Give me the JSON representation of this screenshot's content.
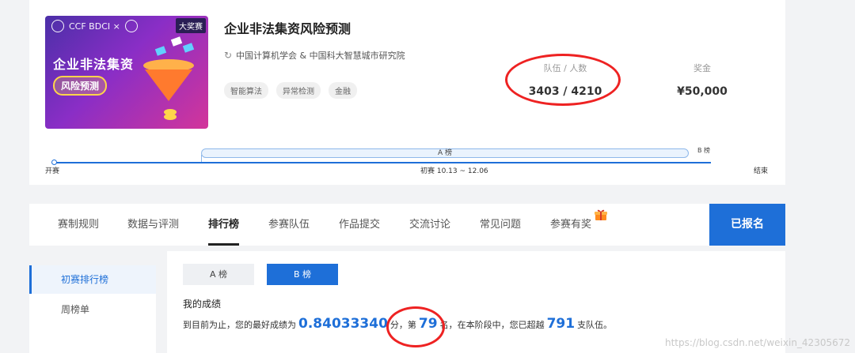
{
  "competition": {
    "banner": {
      "logo_text": "CCF BDCI ×",
      "tag": "大奖赛",
      "title": "企业非法集资",
      "subtitle": "风险预测"
    },
    "title": "企业非法集资风险预测",
    "organizers": "中国计算机学会 & 中国科大智慧城市研究院",
    "tags": [
      "智能算法",
      "异常检测",
      "金融"
    ],
    "stats": {
      "teams_label": "队伍 / 人数",
      "teams_value": "3403 / 4210",
      "prize_label": "奖金",
      "prize_value": "¥50,000"
    }
  },
  "timeline": {
    "start": "开赛",
    "stage": "初赛 10.13 ~ 12.06",
    "end": "结束",
    "a_board": "A 榜",
    "b_board": "B 榜"
  },
  "nav": {
    "tabs": [
      "赛制规则",
      "数据与评测",
      "排行榜",
      "参赛队伍",
      "作品提交",
      "交流讨论",
      "常见问题",
      "参赛有奖"
    ],
    "active_tab": "排行榜",
    "signup": "已报名"
  },
  "sidebar": {
    "items": [
      "初赛排行榜",
      "周榜单"
    ],
    "active": "初赛排行榜"
  },
  "leaderboard": {
    "tab_a": "A 榜",
    "tab_b": "B 榜",
    "active_tab": "B 榜",
    "my_score_label": "我的成绩",
    "prefix": "到目前为止，您的最好成绩为",
    "best_score": "0.84033340",
    "score_unit": "分，",
    "rank_prefix": "第",
    "rank": "79",
    "rank_suffix": "名，在本阶段中，您已超越",
    "surpassed": "791",
    "surpassed_suffix": "支队伍。"
  },
  "watermark": "https://blog.csdn.net/weixin_42305672"
}
